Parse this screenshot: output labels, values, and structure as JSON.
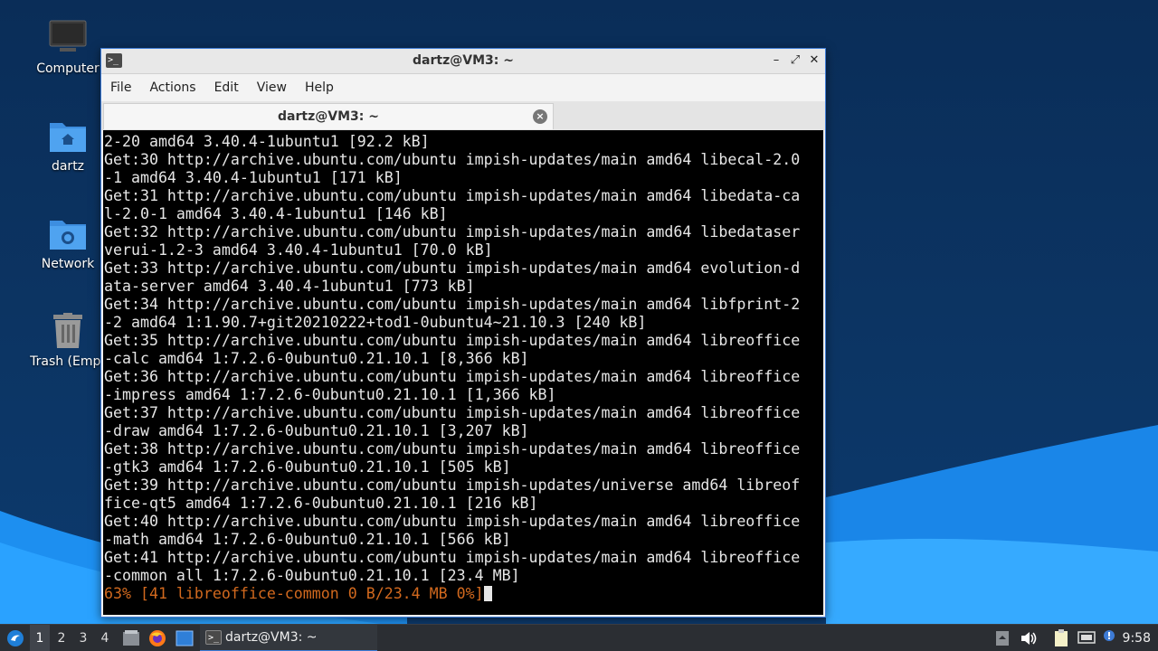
{
  "desktop": {
    "icons": [
      {
        "label": "Computer"
      },
      {
        "label": "dartz"
      },
      {
        "label": "Network"
      },
      {
        "label": "Trash (Empt"
      }
    ]
  },
  "window": {
    "title": "dartz@VM3: ~",
    "menu": [
      "File",
      "Actions",
      "Edit",
      "View",
      "Help"
    ],
    "tab_label": "dartz@VM3: ~"
  },
  "terminal": {
    "lines": [
      "2-20 amd64 3.40.4-1ubuntu1 [92.2 kB]",
      "Get:30 http://archive.ubuntu.com/ubuntu impish-updates/main amd64 libecal-2.0",
      "-1 amd64 3.40.4-1ubuntu1 [171 kB]",
      "Get:31 http://archive.ubuntu.com/ubuntu impish-updates/main amd64 libedata-ca",
      "l-2.0-1 amd64 3.40.4-1ubuntu1 [146 kB]",
      "Get:32 http://archive.ubuntu.com/ubuntu impish-updates/main amd64 libedataser",
      "verui-1.2-3 amd64 3.40.4-1ubuntu1 [70.0 kB]",
      "Get:33 http://archive.ubuntu.com/ubuntu impish-updates/main amd64 evolution-d",
      "ata-server amd64 3.40.4-1ubuntu1 [773 kB]",
      "Get:34 http://archive.ubuntu.com/ubuntu impish-updates/main amd64 libfprint-2",
      "-2 amd64 1:1.90.7+git20210222+tod1-0ubuntu4~21.10.3 [240 kB]",
      "Get:35 http://archive.ubuntu.com/ubuntu impish-updates/main amd64 libreoffice",
      "-calc amd64 1:7.2.6-0ubuntu0.21.10.1 [8,366 kB]",
      "Get:36 http://archive.ubuntu.com/ubuntu impish-updates/main amd64 libreoffice",
      "-impress amd64 1:7.2.6-0ubuntu0.21.10.1 [1,366 kB]",
      "Get:37 http://archive.ubuntu.com/ubuntu impish-updates/main amd64 libreoffice",
      "-draw amd64 1:7.2.6-0ubuntu0.21.10.1 [3,207 kB]",
      "Get:38 http://archive.ubuntu.com/ubuntu impish-updates/main amd64 libreoffice",
      "-gtk3 amd64 1:7.2.6-0ubuntu0.21.10.1 [505 kB]",
      "Get:39 http://archive.ubuntu.com/ubuntu impish-updates/universe amd64 libreof",
      "fice-qt5 amd64 1:7.2.6-0ubuntu0.21.10.1 [216 kB]",
      "Get:40 http://archive.ubuntu.com/ubuntu impish-updates/main amd64 libreoffice",
      "-math amd64 1:7.2.6-0ubuntu0.21.10.1 [566 kB]",
      "Get:41 http://archive.ubuntu.com/ubuntu impish-updates/main amd64 libreoffice",
      "-common all 1:7.2.6-0ubuntu0.21.10.1 [23.4 MB]"
    ],
    "progress_line": "63% [41 libreoffice-common 0 B/23.4 MB 0%]",
    "progress_color": "#d2691e"
  },
  "taskbar": {
    "workspaces": [
      "1",
      "2",
      "3",
      "4"
    ],
    "active_workspace": "1",
    "task_label": "dartz@VM3: ~",
    "clock": "9:58",
    "tray_icons": [
      "keyboard-icon",
      "volume-icon",
      "clipboard-icon",
      "network-icon",
      "notification-icon"
    ]
  },
  "colors": {
    "accent": "#3d7bd6",
    "desktop_bg": "#0c3564",
    "terminal_bg": "#000000",
    "terminal_fg": "#e6e6e6"
  }
}
